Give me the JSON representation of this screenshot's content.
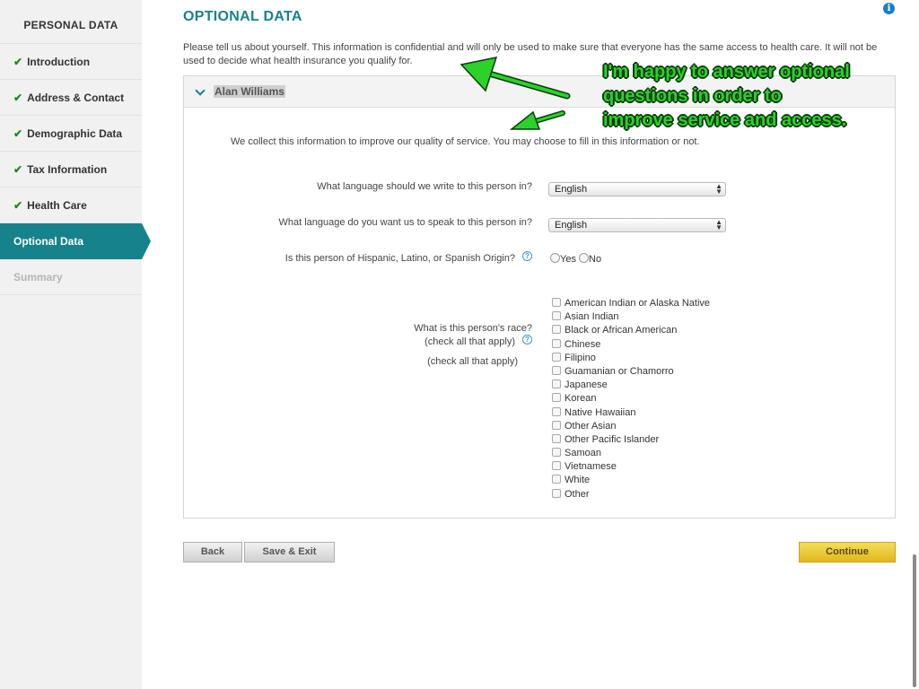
{
  "sidebar": {
    "heading": "PERSONAL DATA",
    "items": [
      {
        "label": "Introduction",
        "state": "done"
      },
      {
        "label": "Address & Contact",
        "state": "done"
      },
      {
        "label": "Demographic Data",
        "state": "done"
      },
      {
        "label": "Tax Information",
        "state": "done"
      },
      {
        "label": "Health Care",
        "state": "done"
      },
      {
        "label": "Optional Data",
        "state": "active"
      },
      {
        "label": "Summary",
        "state": "disabled"
      }
    ]
  },
  "main": {
    "title": "OPTIONAL DATA",
    "intro": "Please tell us about yourself. This information is confidential and will only be used to make sure that everyone has the same access to health care. It will not be used to decide what health insurance you qualify for.",
    "panel": {
      "person_name": "Alan  Williams",
      "note": "We collect this information to improve our quality of service. You may choose to fill in this information or not.",
      "questions": {
        "write_language": {
          "label": "What language should we write to this person in?",
          "value": "English"
        },
        "speak_language": {
          "label": "What language do you want us to speak to this person in?",
          "value": "English"
        },
        "hispanic": {
          "label": "Is this person of Hispanic, Latino, or Spanish Origin?",
          "yes": "Yes",
          "no": "No"
        },
        "race": {
          "label_line1": "What is this person's race?",
          "label_line2": "(check all that apply)",
          "label_line3": "(check all that apply)",
          "options": [
            "American Indian or Alaska Native",
            "Asian Indian",
            "Black or African American",
            "Chinese",
            "Filipino",
            "Guamanian or Chamorro",
            "Japanese",
            "Korean",
            "Native Hawaiian",
            "Other Asian",
            "Other Pacific Islander",
            "Samoan",
            "Vietnamese",
            "White",
            "Other"
          ]
        }
      }
    },
    "buttons": {
      "back": "Back",
      "save_exit": "Save & Exit",
      "continue": "Continue"
    }
  },
  "annotation": {
    "lines": [
      "I'm happy to answer optional",
      "questions in order to",
      "improve service and access."
    ],
    "color": "#2cd12c"
  },
  "colors": {
    "accent": "#16828a",
    "check": "#1f8a2a",
    "continue": "#e8c630"
  },
  "icons": {
    "info": "info-icon",
    "help": "help-icon",
    "check": "check-icon",
    "collapse": "chevron-down-icon"
  }
}
